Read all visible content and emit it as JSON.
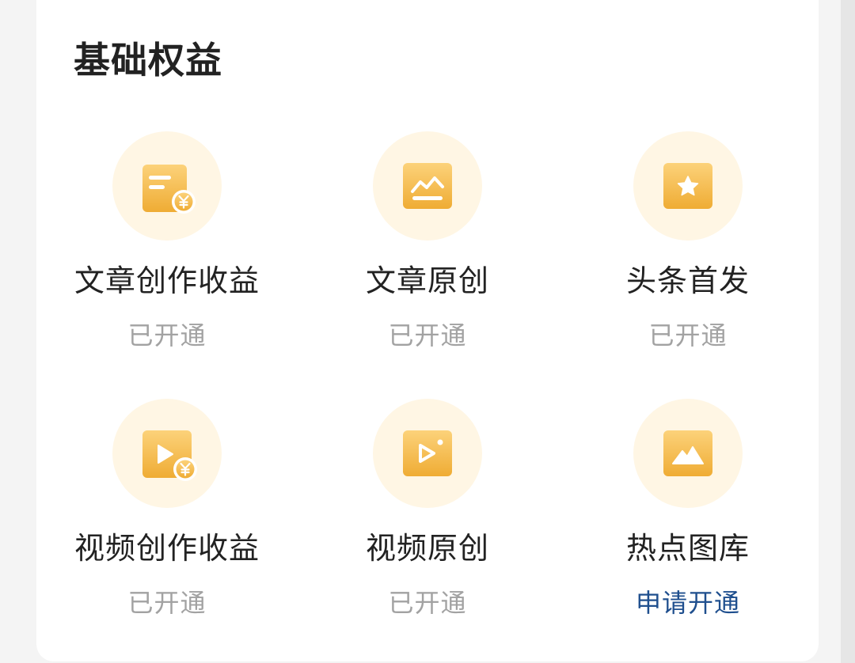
{
  "section": {
    "title": "基础权益"
  },
  "benefits": [
    {
      "name": "文章创作收益",
      "status": "已开通",
      "icon": "article-income-icon"
    },
    {
      "name": "文章原创",
      "status": "已开通",
      "icon": "article-original-icon"
    },
    {
      "name": "头条首发",
      "status": "已开通",
      "icon": "star-icon"
    },
    {
      "name": "视频创作收益",
      "status": "已开通",
      "icon": "video-income-icon"
    },
    {
      "name": "视频原创",
      "status": "已开通",
      "icon": "video-original-icon"
    },
    {
      "name": "热点图库",
      "status": "申请开通",
      "icon": "image-library-icon"
    }
  ],
  "colors": {
    "icon_gradient_top": "#fcd27a",
    "icon_gradient_bottom": "#efac34",
    "icon_halo": "#fff6e4",
    "status_inactive": "#a2a2a2",
    "status_action": "#1f4f8e"
  }
}
